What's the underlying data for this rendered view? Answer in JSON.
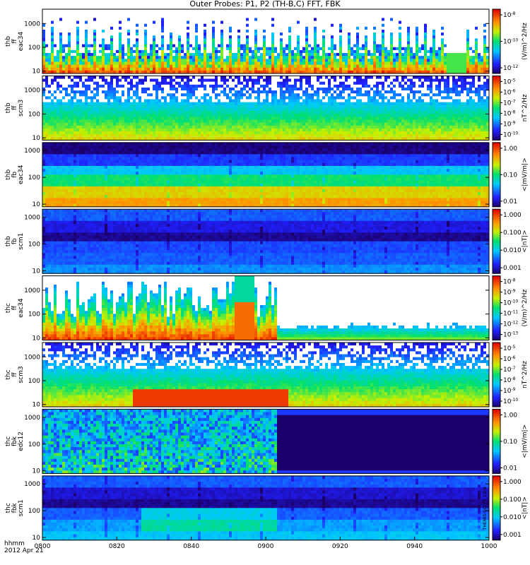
{
  "title": "Outer Probes: P1, P2 (TH-B,C) FFT, FBK",
  "time_axis": {
    "label_line1": "hhmm",
    "label_line2": "2012 Apr 21",
    "ticks": [
      "0800",
      "0820",
      "0840",
      "0900",
      "0920",
      "0940",
      "1000"
    ]
  },
  "footer_note": "THEMIS-SCI PT 1.0.4",
  "chart_data": {
    "type": "heatmap",
    "x_range_hhmm": [
      "0800",
      "1000"
    ],
    "panels": [
      {
        "id": "thb_ff_eac34",
        "label": [
          "thb",
          "ff",
          "eac34"
        ],
        "y_ticks": [
          "1000",
          "100",
          "10"
        ],
        "y_log_range": [
          8,
          4000
        ],
        "colorbar_ticks": [
          "10^-8",
          "10^-10",
          "10^-12"
        ],
        "colorbar_label": "(V/m)^2/Hz",
        "pattern": "bursts",
        "base_level": 0.15,
        "level_gradient": 0.1,
        "burst_cols": 60,
        "gap": [
          0.905,
          0.945
        ],
        "seed": 11
      },
      {
        "id": "thb_ff_scm3",
        "label": [
          "thb",
          "ff",
          "scm3"
        ],
        "y_ticks": [
          "1000",
          "100",
          "10"
        ],
        "y_log_range": [
          8,
          4000
        ],
        "colorbar_ticks": [
          "10^-5",
          "10^-6",
          "10^-7",
          "10^-8",
          "10^-9",
          "10^-10"
        ],
        "colorbar_label": "nT^2/Hz",
        "pattern": "gradient_speckle",
        "base_level": 0.1,
        "level_gradient": 0.62,
        "seed": 12
      },
      {
        "id": "thb_fb_eac34",
        "label": [
          "thb",
          "fb",
          "eac34"
        ],
        "y_ticks": [
          "1000",
          "100",
          "10"
        ],
        "y_log_range": [
          8,
          2000
        ],
        "colorbar_ticks": [
          "1.00",
          "0.10",
          "0.01"
        ],
        "colorbar_label": "<|mV/m|>",
        "pattern": "bands",
        "bands": [
          0.02,
          0.18,
          0.35,
          0.5,
          0.7,
          0.78
        ],
        "seed": 13
      },
      {
        "id": "thb_fb_scm1",
        "label": [
          "thb",
          "fb",
          "scm1"
        ],
        "y_ticks": [
          "1000",
          "100",
          "10"
        ],
        "y_log_range": [
          8,
          2000
        ],
        "colorbar_ticks": [
          "1.000",
          "0.100",
          "0.010",
          "0.001"
        ],
        "colorbar_label": "<|nT|>",
        "pattern": "bands",
        "bands": [
          0.22,
          0.12,
          0.04,
          0.2,
          0.22,
          0.28
        ],
        "seed": 14
      },
      {
        "id": "thc_ff_eac34",
        "label": [
          "thc",
          "ff",
          "eac34"
        ],
        "y_ticks": [
          "1000",
          "100",
          "10"
        ],
        "y_log_range": [
          8,
          4000
        ],
        "colorbar_ticks": [
          "10^-8",
          "10^-9",
          "10^-10",
          "10^-11",
          "10^-12",
          "10^-13"
        ],
        "colorbar_label": "(V/m)^2/Hz",
        "pattern": "storm",
        "active_until": 0.52,
        "seed": 15
      },
      {
        "id": "thc_ff_scm3",
        "label": [
          "thc",
          "ff",
          "scm3"
        ],
        "y_ticks": [
          "1000",
          "100",
          "10"
        ],
        "y_log_range": [
          8,
          4000
        ],
        "colorbar_ticks": [
          "10^-5",
          "10^-6",
          "10^-7",
          "10^-8",
          "10^-9",
          "10^-10"
        ],
        "colorbar_label": "nT^2/Hz",
        "pattern": "gradient_speckle",
        "base_level": 0.12,
        "level_gradient": 0.6,
        "hot_region": [
          0.2,
          0.55
        ],
        "seed": 16
      },
      {
        "id": "thc_fb_edc12",
        "label": [
          "thc",
          "fbk",
          "edc12"
        ],
        "y_ticks": [
          "1000",
          "100",
          "10"
        ],
        "y_log_range": [
          8,
          2000
        ],
        "colorbar_ticks": [
          "1.00",
          "0.10",
          "0.01"
        ],
        "colorbar_label": "<|mV/m|>",
        "pattern": "active_then_quiet",
        "active_until": 0.52,
        "seed": 17
      },
      {
        "id": "thc_fb_scm1",
        "label": [
          "thc",
          "fbk",
          "scm1"
        ],
        "y_ticks": [
          "1000",
          "100",
          "10"
        ],
        "y_log_range": [
          8,
          2000
        ],
        "colorbar_ticks": [
          "1.000",
          "0.100",
          "0.010",
          "0.001"
        ],
        "colorbar_label": "<|nT|>",
        "pattern": "bands",
        "bands": [
          0.22,
          0.1,
          0.04,
          0.22,
          0.3,
          0.35
        ],
        "hot_region": [
          0.22,
          0.52
        ],
        "seed": 18
      }
    ]
  }
}
